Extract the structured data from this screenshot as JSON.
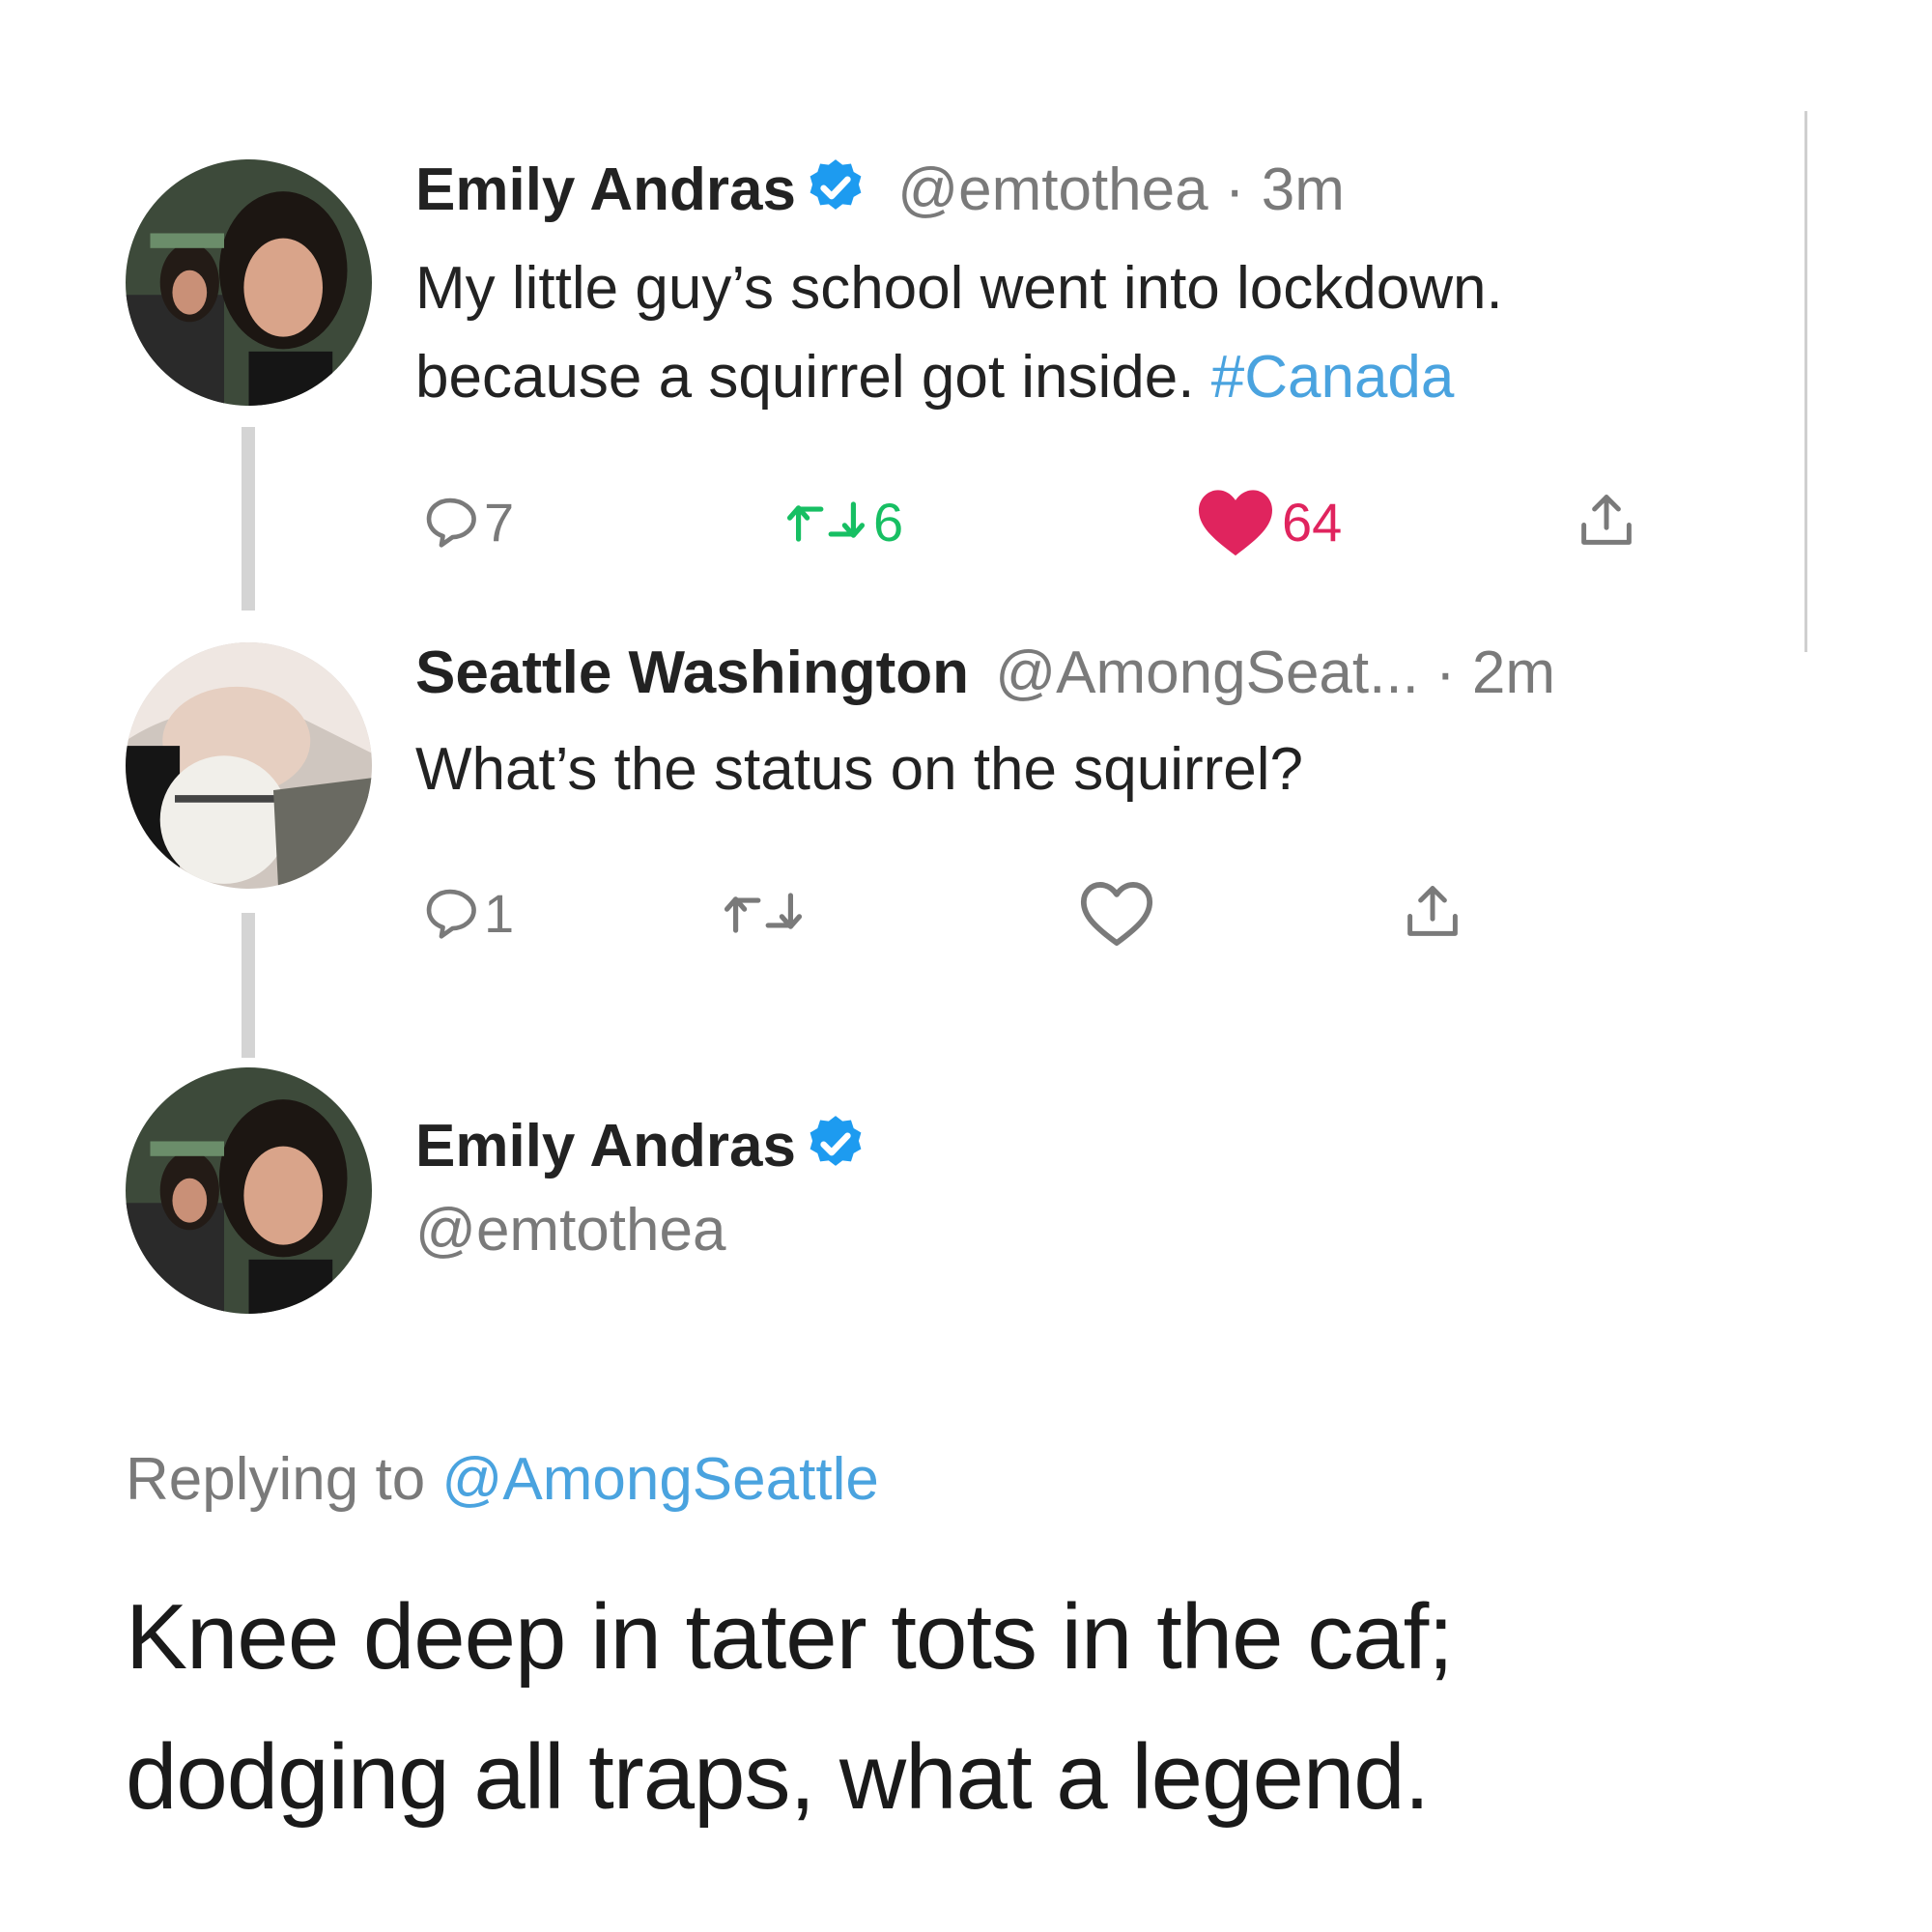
{
  "tweet1": {
    "author_name": "Emily Andras",
    "handle": "@emtothea",
    "time": "3m",
    "text_line1": "My little guy’s school went into lockdown.",
    "text_line2": "because a squirrel got inside. ",
    "hashtag": "#Canada",
    "reply_count": "7",
    "retweet_count": "6",
    "like_count": "64"
  },
  "tweet2": {
    "author_name": "Seattle Washington",
    "handle": "@AmongSeat...",
    "time": "2m",
    "text": "What’s the status on the squirrel?",
    "reply_count": "1"
  },
  "tweet3": {
    "author_name": "Emily Andras",
    "handle": "@emtothea",
    "replying_prefix": "Replying to ",
    "replying_handle": "@AmongSeattle",
    "text_line1": "Knee deep in tater tots in the caf;",
    "text_line2": "dodging all traps, what a legend."
  },
  "colors": {
    "link": "#4aa3df",
    "like": "#e0245e",
    "retweet": "#17bf63",
    "muted": "#7a7a7a",
    "verified": "#1d9bf0"
  },
  "icons": [
    "avatar-emily",
    "avatar-seattle",
    "verified-icon",
    "reply-icon",
    "retweet-icon",
    "heart-icon",
    "share-icon"
  ]
}
